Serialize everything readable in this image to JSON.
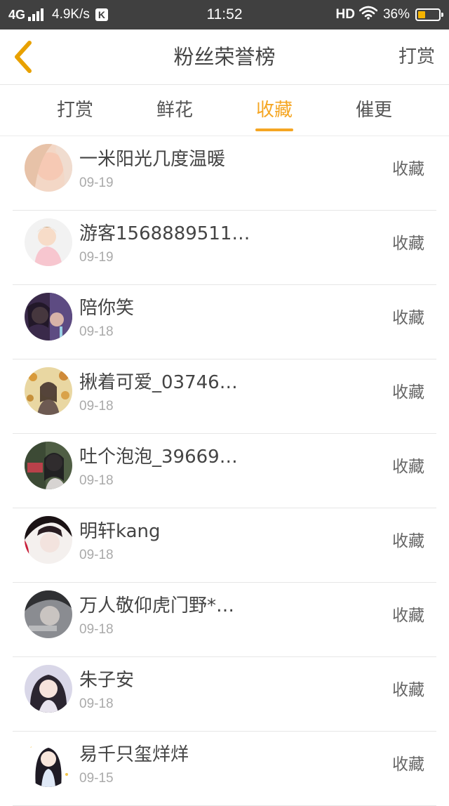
{
  "status_bar": {
    "network": "4G",
    "speed": "4.9K/s",
    "app_badge": "K",
    "time": "11:52",
    "hd": "HD",
    "battery_level": "36%",
    "battery_fraction": 0.36,
    "battery_color": "#f5b400"
  },
  "header": {
    "title": "粉丝荣誉榜",
    "action_label": "打赏",
    "back_icon": "chevron-left-icon",
    "back_color": "#e8a100"
  },
  "tabs": [
    {
      "label": "打赏",
      "active": false
    },
    {
      "label": "鲜花",
      "active": false
    },
    {
      "label": "收藏",
      "active": true
    },
    {
      "label": "催更",
      "active": false
    }
  ],
  "accent_color": "#f5a623",
  "fans": [
    {
      "name": "一米阳光几度温暖",
      "date": "09-19",
      "kind": "收藏"
    },
    {
      "name": "游客1568889511…",
      "date": "09-19",
      "kind": "收藏"
    },
    {
      "name": "陪你笑",
      "date": "09-18",
      "kind": "收藏"
    },
    {
      "name": "揪着可爱_03746…",
      "date": "09-18",
      "kind": "收藏"
    },
    {
      "name": "吐个泡泡_39669…",
      "date": "09-18",
      "kind": "收藏"
    },
    {
      "name": "明轩kang",
      "date": "09-18",
      "kind": "收藏"
    },
    {
      "name": "万人敬仰虎门野*…",
      "date": "09-18",
      "kind": "收藏"
    },
    {
      "name": "朱子安",
      "date": "09-18",
      "kind": "收藏"
    },
    {
      "name": "易千只玺烊烊",
      "date": "09-15",
      "kind": "收藏"
    }
  ]
}
